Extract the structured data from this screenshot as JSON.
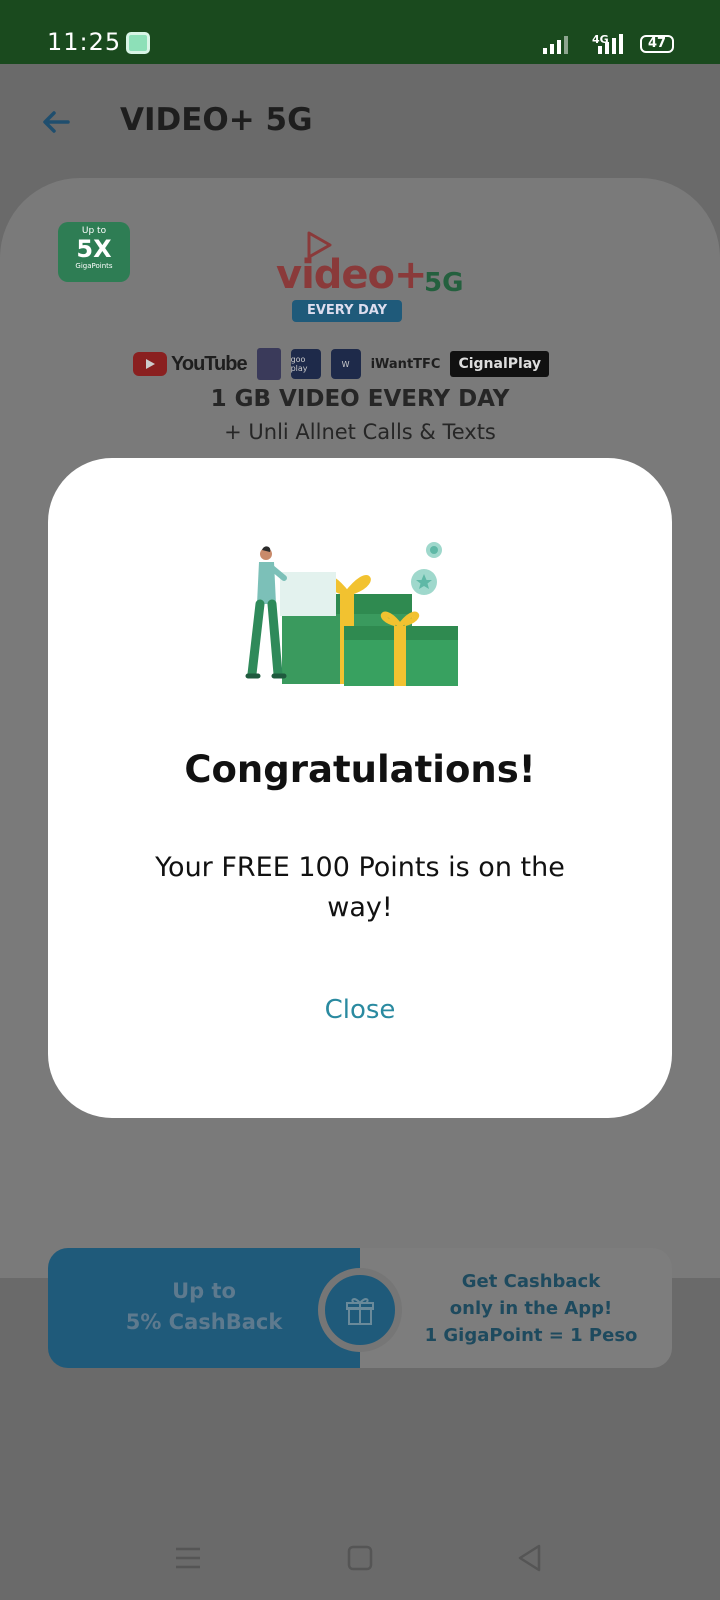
{
  "status_bar": {
    "time": "11:25",
    "network": "4G",
    "battery": "47"
  },
  "header": {
    "title": "VIDEO+ 5G"
  },
  "promo": {
    "badge_top": "Up to",
    "badge_main": "5X",
    "badge_bottom": "GigaPoints",
    "logo_text": "video+",
    "logo_5g": "5G",
    "logo_tag": "EVERY DAY",
    "partners": {
      "youtube": "YouTube",
      "gopay": "goo play",
      "iwant": "iWantTFC",
      "cignal": "CignalPlay"
    },
    "headline": "1 GB VIDEO EVERY DAY",
    "subline": "+ Unli Allnet Calls & Texts"
  },
  "cashback": {
    "left_line1": "Up to",
    "left_line2": "5% CashBack",
    "right_line1": "Get Cashback",
    "right_line2": "only in the App!",
    "right_line3": "1 GigaPoint = 1 Peso"
  },
  "modal": {
    "title": "Congratulations!",
    "message": "Your FREE 100 Points is on the way!",
    "close_label": "Close"
  },
  "colors": {
    "status_bar": "#1a4a1e",
    "accent_close": "#2a8aa0",
    "gift_green": "#3a9a5e",
    "gift_ribbon": "#f2c230",
    "overlay": "#6a6a6a"
  }
}
